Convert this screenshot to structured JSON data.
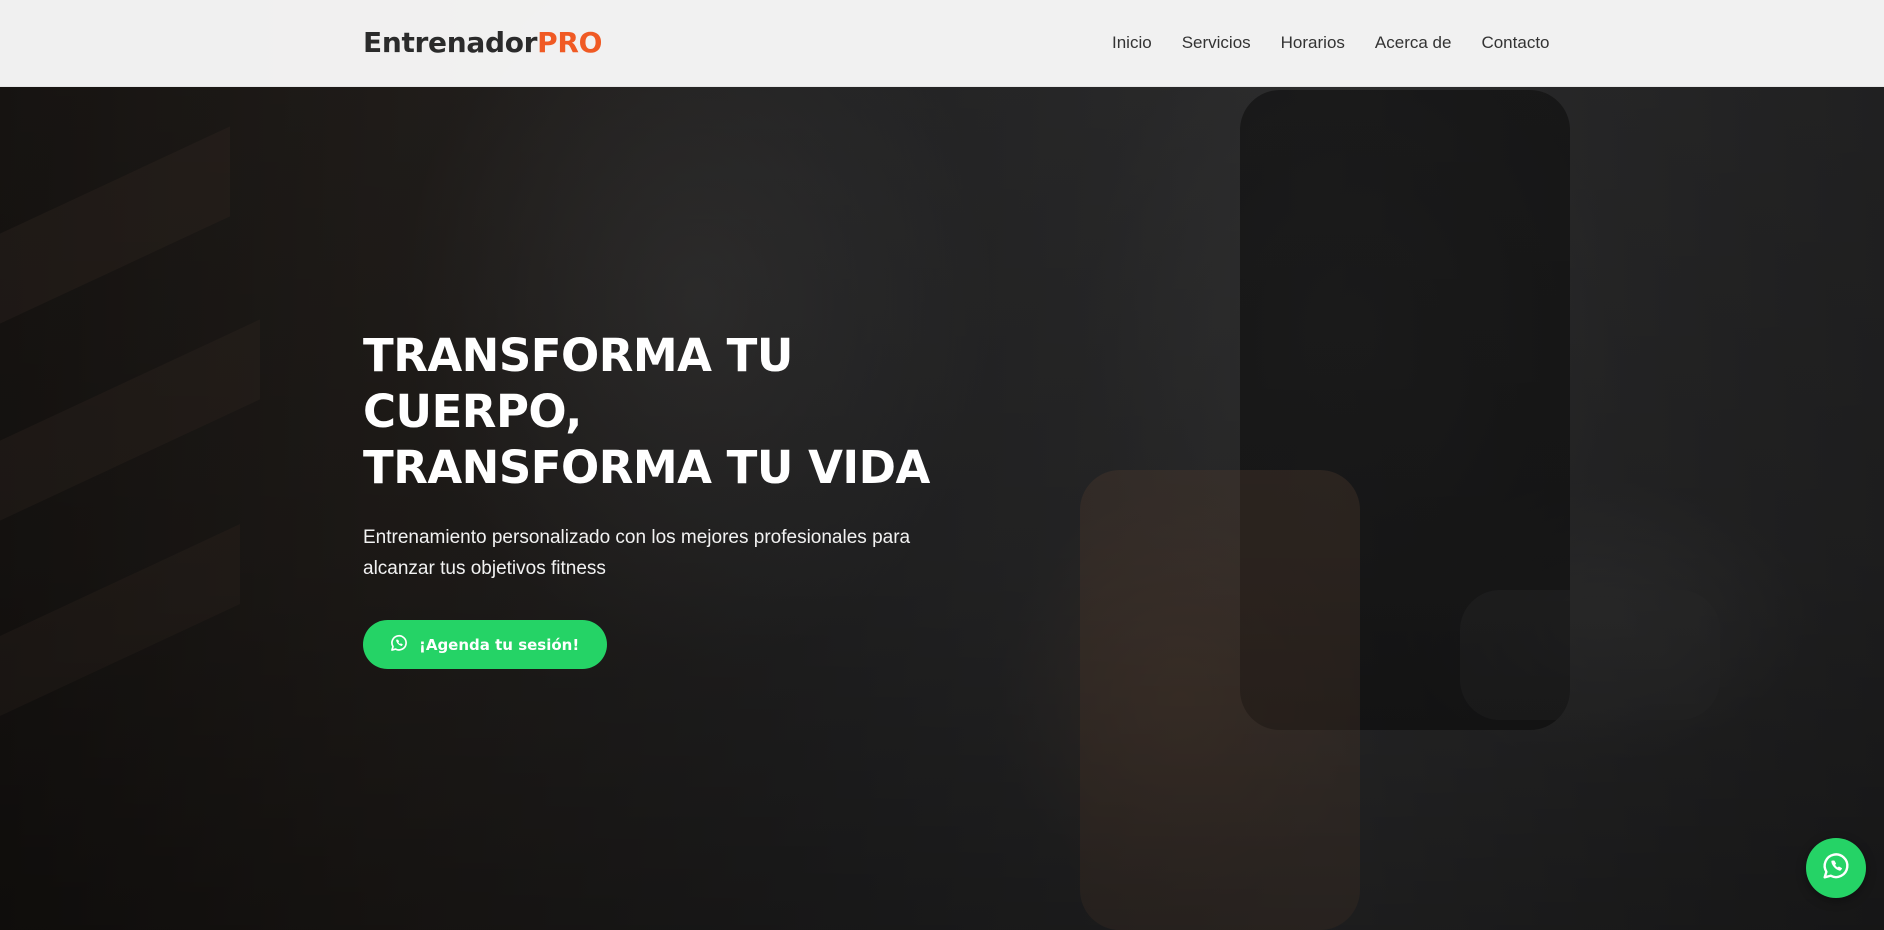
{
  "navbar": {
    "brand_main": "Entrenador",
    "brand_accent": "PRO",
    "links": [
      {
        "label": "Inicio"
      },
      {
        "label": "Servicios"
      },
      {
        "label": "Horarios"
      },
      {
        "label": "Acerca de"
      },
      {
        "label": "Contacto"
      }
    ]
  },
  "hero": {
    "title_line1": "TRANSFORMA TU CUERPO,",
    "title_line2": "TRANSFORMA TU VIDA",
    "subtitle": "Entrenamiento personalizado con los mejores profesionales para alcanzar tus objetivos fitness",
    "cta_label": "¡Agenda tu sesión!",
    "cta_icon": "whatsapp-icon"
  },
  "floating_button": {
    "icon": "whatsapp-icon"
  },
  "colors": {
    "brand_accent": "#f05a24",
    "whatsapp_green": "#25d366",
    "navbar_bg": "#f8f8f8"
  }
}
